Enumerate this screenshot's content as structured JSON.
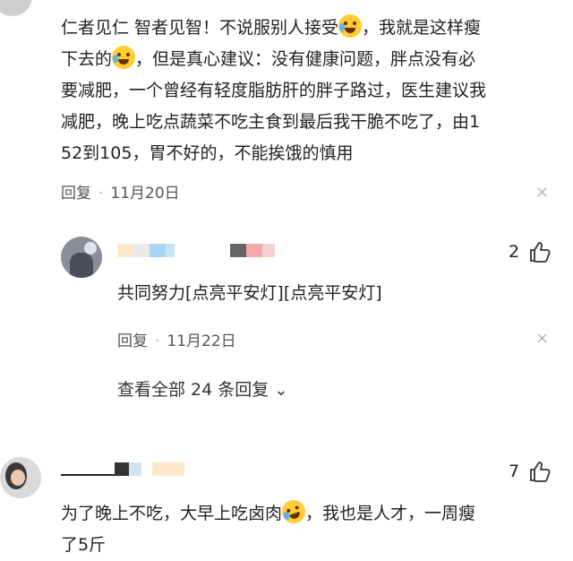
{
  "comments": [
    {
      "text_lines": [
        "仁者见仁 智者见智！不说服别人接受",
        "，我就是这样瘦",
        "下去的",
        "，但是真心建议：没有健康问题，胖点没有必",
        "要减肥，一个曾经有轻度脂肪肝的胖子路过，医生建议我",
        "减肥，晚上吃点蔬菜不吃主食到最后我干脆不吃了，由1",
        "52到105，胃不好的，不能挨饿的慎用"
      ],
      "emoji_1": "crying-laughing-emoji",
      "emoji_2": "crying-laughing-emoji",
      "reply_label": "回复",
      "dot": "·",
      "date": "11月20日",
      "close_glyph": "×"
    },
    {
      "like_count": "2",
      "text": "共同努力[点亮平安灯][点亮平安灯]",
      "reply_label": "回复",
      "dot": "·",
      "date": "11月22日",
      "close_glyph": "×",
      "expand_label": "查看全部 24 条回复",
      "expand_chevron": "⌄"
    },
    {
      "like_count": "7",
      "text_lines": [
        "为了晚上不吃，大早上吃卤肉",
        "，我也是人才，一周瘦",
        "了5斤"
      ],
      "emoji": "rofl-emoji"
    }
  ],
  "colors": {
    "text": "#222222",
    "meta": "#555555",
    "close": "#b5b5b5",
    "emoji_yellow": "#ffcc33"
  }
}
